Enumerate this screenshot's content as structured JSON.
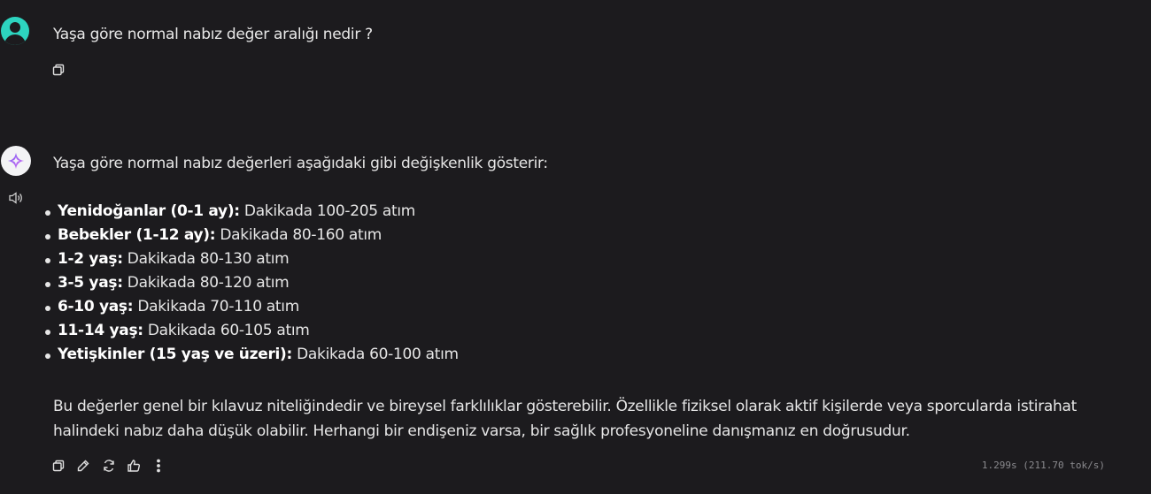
{
  "user_message": {
    "text": "Yaşa göre normal nabız değer aralığı nedir ?"
  },
  "assistant_message": {
    "intro": "Yaşa göre normal nabız değerleri aşağıdaki gibi değişkenlik gösterir:",
    "items": [
      {
        "label": "Yenidoğanlar (0-1 ay):",
        "value": " Dakikada 100-205 atım"
      },
      {
        "label": "Bebekler (1-12 ay):",
        "value": " Dakikada 80-160 atım"
      },
      {
        "label": "1-2 yaş:",
        "value": " Dakikada 80-130 atım"
      },
      {
        "label": "3-5 yaş:",
        "value": " Dakikada 80-120 atım"
      },
      {
        "label": "6-10 yaş:",
        "value": " Dakikada 70-110 atım"
      },
      {
        "label": "11-14 yaş:",
        "value": " Dakikada 60-105 atım"
      },
      {
        "label": "Yetişkinler (15 yaş ve üzeri):",
        "value": " Dakikada 60-100 atım"
      }
    ],
    "closing": "Bu değerler genel bir kılavuz niteliğindedir ve bireysel farklılıklar gösterebilir. Özellikle fiziksel olarak aktif kişilerde veya sporcularda istirahat halindeki nabız daha düşük olabilir. Herhangi bir endişeniz varsa, bir sağlık profesyoneline danışmanız en doğrusudur.",
    "stats": "1.299s (211.70 tok/s)"
  },
  "icons": {
    "user_avatar": "user-icon",
    "ai_avatar": "sparkle-icon",
    "speaker": "speaker-icon",
    "copy": "copy-icon",
    "edit": "edit-icon",
    "regenerate": "refresh-icon",
    "like": "thumbs-up-icon",
    "more": "more-vertical-icon"
  },
  "colors": {
    "background": "#1c1b1e",
    "user_avatar": "#2dd4bf",
    "text": "#e6e6e6"
  }
}
